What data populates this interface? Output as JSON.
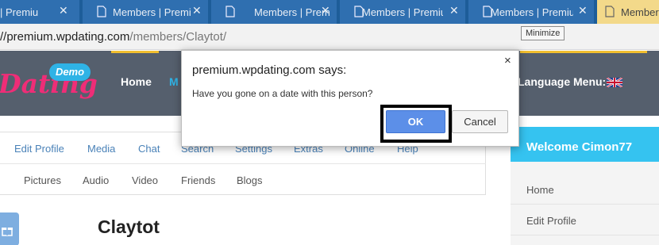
{
  "browser": {
    "tabs": [
      {
        "title": "| Premiu",
        "active": false
      },
      {
        "title": "Members | Premiu",
        "active": false
      },
      {
        "title": "Members | Premiu",
        "active": false
      },
      {
        "title": "Members | Premiu",
        "active": false
      },
      {
        "title": "Members | Premiu",
        "active": false
      },
      {
        "title": "Members",
        "active": true
      }
    ],
    "url_host": "//premium.wpdating.com",
    "url_path": "/members/Claytot/",
    "tooltip": "Minimize"
  },
  "site": {
    "logo_text": "Dating",
    "demo_badge": "Demo",
    "nav_home": "Home",
    "nav_members": "M",
    "language_label": "Language Menu:"
  },
  "profile_nav": [
    "Edit Profile",
    "Media",
    "Chat",
    "Search",
    "Settings",
    "Extras",
    "Online",
    "Help"
  ],
  "sub_nav": [
    "Pictures",
    "Audio",
    "Video",
    "Friends",
    "Blogs"
  ],
  "profile_name": "Claytot",
  "sidebar": {
    "welcome": "Welcome Cimon77",
    "items": [
      "Home",
      "Edit Profile"
    ]
  },
  "dialog": {
    "title": "premium.wpdating.com says:",
    "message": "Have you gone on a date with this person?",
    "ok_label": "OK",
    "cancel_label": "Cancel",
    "close_glyph": "×"
  },
  "colors": {
    "tab_strip": "#1d5d99",
    "active_tab": "#f3d98a",
    "header": "#555f6d",
    "accent_pink": "#ef2d77",
    "accent_blue": "#35c3f0",
    "ok_button": "#5c8fe8"
  }
}
